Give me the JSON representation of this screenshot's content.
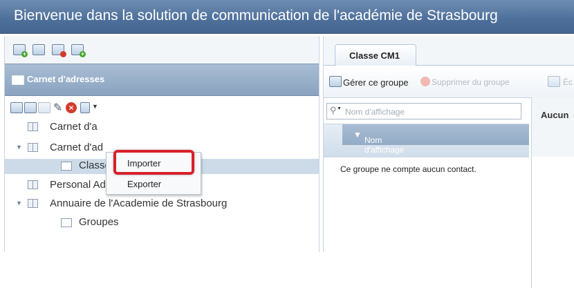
{
  "window": {
    "title": "Bienvenue dans la solution de communication de l'académie de Strasbourg"
  },
  "left_panel": {
    "header_title": "Carnet d'adresses",
    "tree": [
      {
        "label": "Carnet d'a",
        "icon": "address-book-icon",
        "expanded": false
      },
      {
        "label": "Carnet d'ad",
        "icon": "address-book-icon",
        "expanded": true
      },
      {
        "label": "Classe CM1",
        "icon": "group-icon",
        "selected": true
      },
      {
        "label": "Personal Address Book",
        "icon": "address-book-icon"
      },
      {
        "label": "Annuaire de l'Academie de Strasbourg",
        "icon": "address-book-icon",
        "expanded": true
      },
      {
        "label": "Groupes",
        "icon": "group-icon"
      }
    ]
  },
  "menu": {
    "items": [
      "Importer",
      "Exporter"
    ],
    "highlighted": "Importer"
  },
  "right_panel": {
    "tab_label": "Classe CM1",
    "toolbar": {
      "manage_group": "Gérer ce groupe",
      "delete_group": "Supprimer du groupe",
      "truncated": "Éc"
    },
    "search_placeholder": "Nom d'affichage",
    "column_header": "Nom d'affichage",
    "empty_message": "Ce groupe ne compte aucun contact.",
    "detail_header": "Aucun"
  },
  "colors": {
    "titlebar": "#4d6f9a",
    "panel_header": "#93abc6",
    "highlight_box": "#d9202b",
    "selected_row": "#cddbe9"
  }
}
